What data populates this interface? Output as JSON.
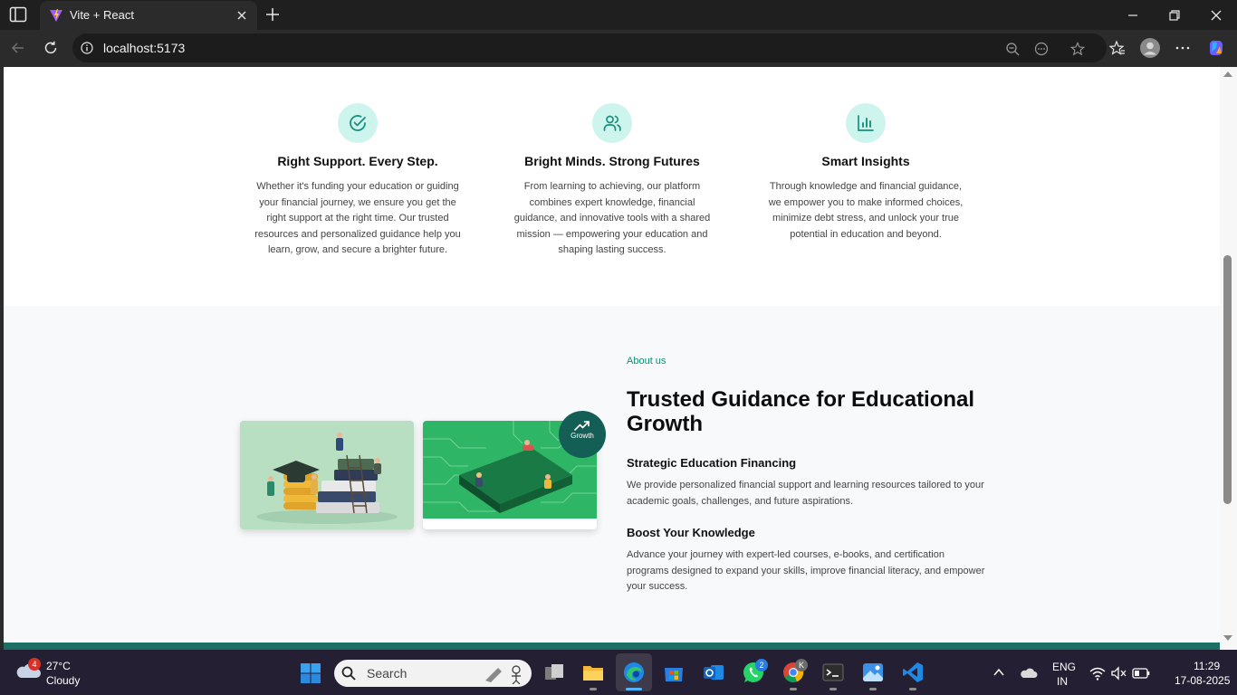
{
  "browser": {
    "tab_title": "Vite + React",
    "url": "localhost:5173"
  },
  "features": [
    {
      "icon": "check-circle-icon",
      "title": "Right Support. Every Step.",
      "text": "Whether it's funding your education or guiding your financial journey, we ensure you get the right support at the right time. Our trusted resources and personalized guidance help you learn, grow, and secure a brighter future."
    },
    {
      "icon": "users-icon",
      "title": "Bright Minds. Strong Futures",
      "text": "From learning to achieving, our platform combines expert knowledge, financial guidance, and innovative tools with a shared mission — empowering your education and shaping lasting success."
    },
    {
      "icon": "bar-chart-icon",
      "title": "Smart Insights",
      "text": "Through knowledge and financial guidance, we empower you to make informed choices, minimize debt stress, and unlock your true potential in education and beyond."
    }
  ],
  "about": {
    "kicker": "About us",
    "title": "Trusted Guidance for Educational Growth",
    "badge_label": "Growth",
    "items": [
      {
        "heading": "Strategic Education Financing",
        "text": "We provide personalized financial support and learning resources tailored to your academic goals, challenges, and future aspirations."
      },
      {
        "heading": "Boost Your Knowledge",
        "text": "Advance your journey with expert-led courses, e-books, and certification programs designed to expand your skills, improve financial literacy, and empower your success."
      }
    ]
  },
  "taskbar": {
    "weather_badge": "4",
    "temperature": "27°C",
    "condition": "Cloudy",
    "search_placeholder": "Search",
    "whatsapp_badge": "2",
    "chrome_badge": "K",
    "language": "ENG",
    "region": "IN",
    "time": "11:29",
    "date": "17-08-2025"
  },
  "colors": {
    "accent": "#178a74",
    "badge_bg": "#135e55",
    "icon_circle": "#cdf5ee"
  }
}
